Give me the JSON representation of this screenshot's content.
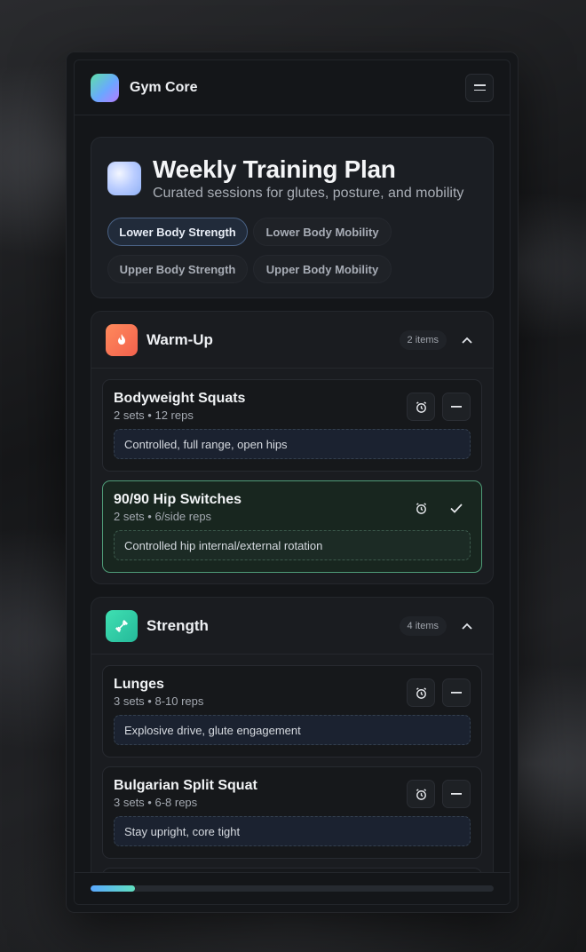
{
  "app": {
    "name": "Gym Core"
  },
  "hero": {
    "title": "Weekly Training Plan",
    "subtitle": "Curated sessions for glutes, posture, and mobility",
    "chips": [
      "Lower Body Strength",
      "Lower Body Mobility",
      "Upper Body Strength",
      "Upper Body Mobility"
    ],
    "active_chip": "Lower Body Strength"
  },
  "sections": [
    {
      "title": "Warm-Up",
      "count": "2 items",
      "icon": "flame-icon",
      "exercises": [
        {
          "name": "Bodyweight Squats",
          "meta": "2 sets • 12 reps",
          "note": "Controlled, full range, open hips",
          "done": false
        },
        {
          "name": "90/90 Hip Switches",
          "meta": "2 sets • 6/side reps",
          "note": "Controlled hip internal/external rotation",
          "done": true
        }
      ]
    },
    {
      "title": "Strength",
      "count": "4 items",
      "icon": "dumbbell-icon",
      "exercises": [
        {
          "name": "Lunges",
          "meta": "3 sets • 8-10 reps",
          "note": "Explosive drive, glute engagement",
          "done": false
        },
        {
          "name": "Bulgarian Split Squat",
          "meta": "3 sets • 6-8 reps",
          "note": "Stay upright, core tight",
          "done": false
        }
      ]
    }
  ],
  "progress": {
    "fraction": 0.11
  },
  "colors": {
    "accent": "#5aa8ff",
    "done_border": "#4f9c78",
    "warm": "#f2614d",
    "strength": "#25b99a"
  }
}
